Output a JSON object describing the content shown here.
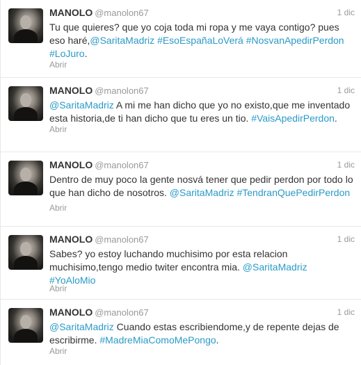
{
  "tweets": [
    {
      "name": "MANOLO",
      "handle": "@manolon67",
      "time": "1 dic",
      "segments": [
        {
          "t": "Tu que quieres? que yo coja toda mi ropa y me vaya contigo? pues eso haré,",
          "link": false
        },
        {
          "t": "@SaritaMadriz",
          "link": true
        },
        {
          "t": " ",
          "link": false
        },
        {
          "t": "#EsoEspañaLoVerá",
          "link": true
        },
        {
          "t": " ",
          "link": false
        },
        {
          "t": "#NosvanApedirPerdon",
          "link": true
        },
        {
          "t": " ",
          "link": false
        },
        {
          "t": "#LoJuro",
          "link": true
        },
        {
          "t": ".",
          "link": false
        }
      ],
      "action": "Abrir"
    },
    {
      "name": "MANOLO",
      "handle": "@manolon67",
      "time": "1 dic",
      "segments": [
        {
          "t": "@SaritaMadriz",
          "link": true
        },
        {
          "t": " A mi me han dicho que yo no existo,que me inventado esta historia,de ti han dicho que tu eres un tio. ",
          "link": false
        },
        {
          "t": "#VaisApedirPerdon",
          "link": true
        },
        {
          "t": ".",
          "link": false
        }
      ],
      "action": "Abrir"
    },
    {
      "name": "MANOLO",
      "handle": "@manolon67",
      "time": "1 dic",
      "segments": [
        {
          "t": "Dentro de muy poco la gente nosvá tener que pedir perdon por todo lo que han dicho de nosotros. ",
          "link": false
        },
        {
          "t": "@SaritaMadriz",
          "link": true
        },
        {
          "t": " ",
          "link": false
        },
        {
          "t": "#TendranQuePedirPerdon",
          "link": true
        }
      ],
      "action": "Abrir"
    },
    {
      "name": "MANOLO",
      "handle": "@manolon67",
      "time": "1 dic",
      "segments": [
        {
          "t": "Sabes? yo estoy luchando muchisimo por esta relacion muchisimo,tengo medio twiter encontra mia. ",
          "link": false
        },
        {
          "t": "@SaritaMadriz",
          "link": true
        },
        {
          "t": " ",
          "link": false
        },
        {
          "t": "#YoAloMio",
          "link": true
        }
      ],
      "action": "Abrir"
    },
    {
      "name": "MANOLO",
      "handle": "@manolon67",
      "time": "1 dic",
      "segments": [
        {
          "t": "@SaritaMadriz",
          "link": true
        },
        {
          "t": " Cuando estas escribiendome,y de repente dejas de escribirme. ",
          "link": false
        },
        {
          "t": "#MadreMiaComoMePongo",
          "link": true
        },
        {
          "t": ".",
          "link": false
        }
      ],
      "action": "Abrir"
    }
  ]
}
